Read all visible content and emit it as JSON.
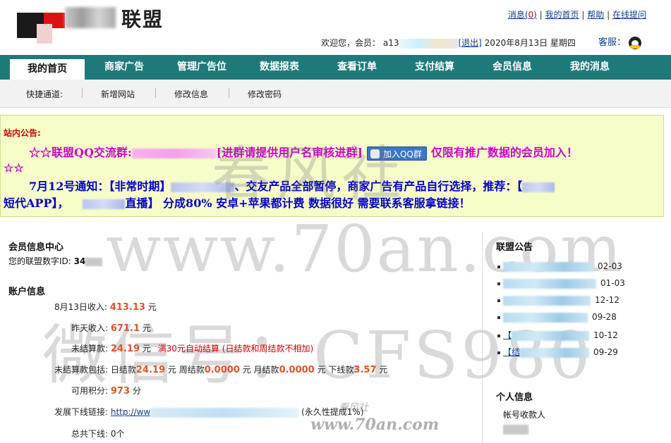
{
  "header": {
    "site_name": "联盟",
    "links": {
      "message_label": "消息(",
      "message_count": "0",
      "message_close": ")",
      "home": "我的首页",
      "help": "帮助",
      "online_qa": "在线提问",
      "sep": "|"
    },
    "welcome_prefix": "欢迎您，会员：",
    "username": "a13",
    "logout": "[退出]",
    "date": "2020年8月13日 星期四",
    "service_label": "客服："
  },
  "nav": {
    "tabs": [
      "我的首页",
      "商家广告",
      "管理广告位",
      "数据报表",
      "查看订单",
      "支付结算",
      "会员信息",
      "我的消息"
    ],
    "active": "我的首页"
  },
  "subnav": {
    "items": [
      "快捷通道:",
      "新增网站",
      "修改信息",
      "修改密码"
    ]
  },
  "notice": {
    "title": "站内公告:",
    "line1_prefix": "☆☆联盟QQ交流群:",
    "line1_join": "[进群请提供用户名审核进群]",
    "qq_button": "加入QQ群",
    "line1_suffix": "仅限有推广数据的会员加入！",
    "line1_tail": "☆☆",
    "line2_a": "7月12号通知：【非常时期】",
    "line2_b": "、交友产品全部暂停，商家广告有产品自行选择，推荐：【",
    "line3_a": "短代APP】，",
    "line3_b": "直播】 分成80% 安卓+苹果都计费 数据很好 需要联系客服拿链接！"
  },
  "member_center": {
    "title": "会员信息中心",
    "id_label": "您的联盟数字ID:",
    "id_value": "34"
  },
  "account": {
    "title": "账户信息",
    "today_label": "8月13日收入:",
    "today_value": "413.13",
    "unit": "元",
    "yesterday_label": "昨天收入:",
    "yesterday_value": "671.1",
    "unsettled_label": "未结算款:",
    "unsettled_value": "24.19",
    "unsettled_note": "满30元自动结算 (日结款和周结款不相加)",
    "includes_label": "未结算款包括:",
    "daily_label": "日结款",
    "daily_value": "24.19",
    "weekly_label": "周结款",
    "weekly_value": "0.0000",
    "monthly_label": "月结款",
    "monthly_value": "0.0000",
    "downline_label": "下线款",
    "downline_value": "3.57",
    "points_label": "可用积分:",
    "points_value": "973",
    "points_unit": "分",
    "link_label": "发展下线链接:",
    "link_value": "http://ww",
    "link_note": "(永久性提成1%)",
    "total_label": "总共下线:",
    "total_value": "0个"
  },
  "announcements": {
    "title": "联盟公告",
    "items": [
      {
        "date": "02-03"
      },
      {
        "date": "01-03"
      },
      {
        "date": "12-12"
      },
      {
        "date": "09-28"
      },
      {
        "prefix": "【",
        "date": "10-12"
      },
      {
        "prefix": "【结",
        "date": "09-29"
      }
    ]
  },
  "personal": {
    "title": "个人信息",
    "account_label": "帐号收款人"
  },
  "watermarks": {
    "w1": "春风社",
    "w2": "www.70an.com",
    "w3": "微信号：CFS980",
    "w4": "www.70an.com",
    "w5": "春风社"
  }
}
